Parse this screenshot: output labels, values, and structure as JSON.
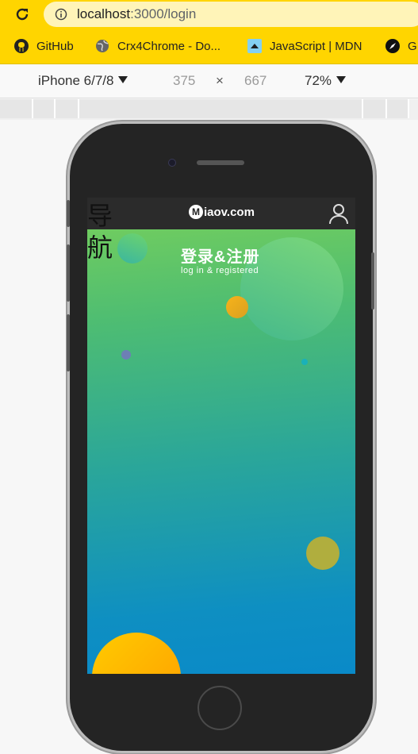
{
  "browser": {
    "url_host": "localhost",
    "url_path": ":3000/login",
    "bookmarks": [
      {
        "label": "GitHub",
        "icon": "github-icon"
      },
      {
        "label": "Crx4Chrome - Do...",
        "icon": "globe-icon"
      },
      {
        "label": "JavaScript | MDN",
        "icon": "mdn-icon"
      },
      {
        "label": "G",
        "icon": "compass-icon"
      }
    ]
  },
  "device_toolbar": {
    "device": "iPhone 6/7/8",
    "width": "375",
    "times": "×",
    "height": "667",
    "zoom": "72%"
  },
  "app": {
    "logo_mark": "M",
    "logo_text": "iaov.com",
    "nav_label": "导航",
    "title": "登录&注册",
    "subtitle": "log in & registered"
  },
  "colors": {
    "browser_accent": "#ffd500",
    "header_bg": "#2b2b2b",
    "gradient_top": "#7ad15a",
    "gradient_bottom": "#0a8ac8"
  }
}
